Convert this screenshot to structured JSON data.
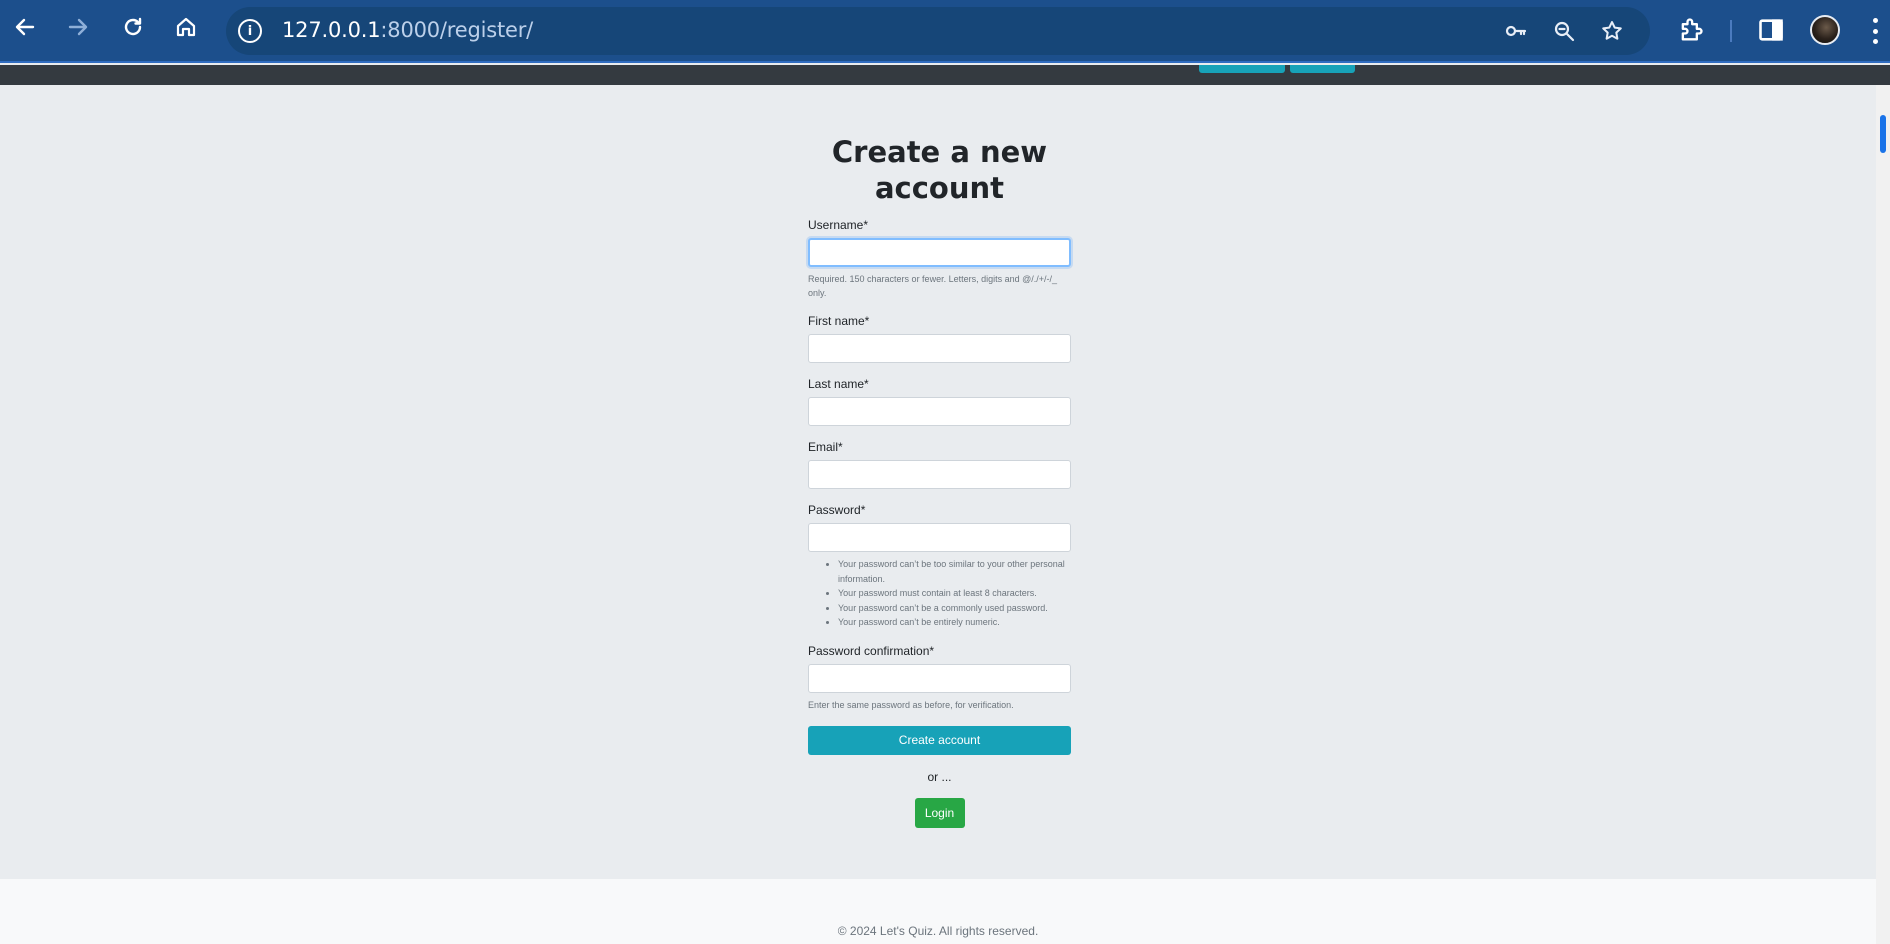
{
  "browser": {
    "url_host": "127.0.0.1",
    "url_path": ":8000/register/"
  },
  "page": {
    "title": "Create a new account"
  },
  "form": {
    "username_label": "Username*",
    "username_help": "Required. 150 characters or fewer. Letters, digits and @/./+/-/_ only.",
    "first_name_label": "First name*",
    "last_name_label": "Last name*",
    "email_label": "Email*",
    "password_label": "Password*",
    "password_help": [
      "Your password can’t be too similar to your other personal information.",
      "Your password must contain at least 8 characters.",
      "Your password can’t be a commonly used password.",
      "Your password can’t be entirely numeric."
    ],
    "password_confirmation_label": "Password confirmation*",
    "password_confirmation_help": "Enter the same password as before, for verification.",
    "submit_label": "Create account",
    "or_text": "or ...",
    "login_label": "Login"
  },
  "footer": {
    "text": "© 2024 Let's Quiz.  All rights reserved."
  },
  "colors": {
    "browser_bar": "#1c4f8c",
    "create_button": "#17a2b8",
    "login_button": "#28a745",
    "page_bg": "#e9ecef"
  },
  "icons": [
    "back-arrow-icon",
    "forward-arrow-icon",
    "reload-icon",
    "home-icon",
    "site-info-icon",
    "key-icon",
    "zoom-out-icon",
    "star-icon",
    "extensions-icon",
    "side-panel-icon",
    "profile-avatar",
    "more-menu-icon"
  ]
}
